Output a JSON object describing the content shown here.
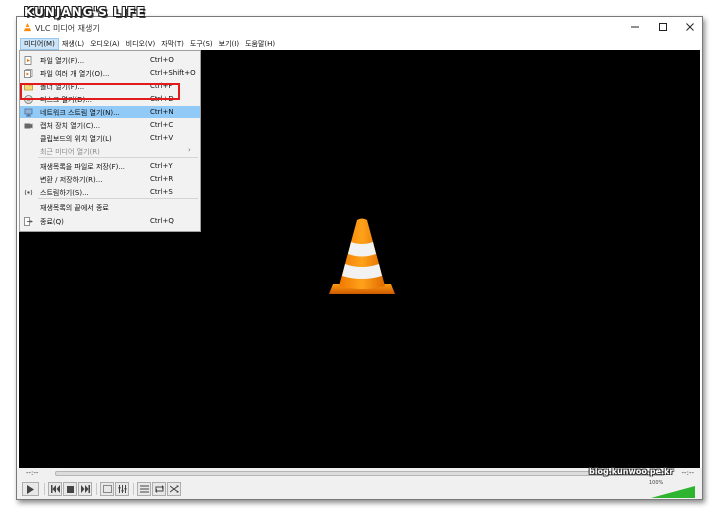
{
  "watermark": "KUNJANG'S LIFE",
  "site_mark": "blog.kunwoo.pe.kr",
  "window": {
    "title": "VLC 미디어 재생기",
    "min_icon": "minimize-icon",
    "max_icon": "maximize-icon",
    "close_icon": "close-icon"
  },
  "menubar": [
    {
      "label": "미디어(M)"
    },
    {
      "label": "재생(L)"
    },
    {
      "label": "오디오(A)"
    },
    {
      "label": "비디오(V)"
    },
    {
      "label": "자막(T)"
    },
    {
      "label": "도구(S)"
    },
    {
      "label": "보기(I)"
    },
    {
      "label": "도움말(H)"
    }
  ],
  "media_menu": [
    {
      "label": "파일 열기(F)...",
      "shortcut": "Ctrl+O",
      "icon": "file-open-icon"
    },
    {
      "label": "파일 여러 개 열기(O)...",
      "shortcut": "Ctrl+Shift+O",
      "icon": "files-open-icon"
    },
    {
      "label": "폴더 열기(F)...",
      "shortcut": "Ctrl+F",
      "icon": "folder-icon"
    },
    {
      "label": "디스크 열기(D)...",
      "shortcut": "Ctrl+D",
      "icon": "disc-icon"
    },
    {
      "label": "네트워크 스트림 열기(N)...",
      "shortcut": "Ctrl+N",
      "icon": "network-icon"
    },
    {
      "label": "캡처 장치 열기(C)...",
      "shortcut": "Ctrl+C",
      "icon": "capture-icon"
    },
    {
      "label": "클립보드의 위치 열기(L)",
      "shortcut": "Ctrl+V",
      "icon": ""
    },
    {
      "label": "최근 미디어 열기(R)",
      "shortcut": "",
      "icon": ""
    },
    {
      "label": "재생목록을 파일로 저장(F)...",
      "shortcut": "Ctrl+Y",
      "icon": ""
    },
    {
      "label": "변환 / 저장하기(R)...",
      "shortcut": "Ctrl+R",
      "icon": ""
    },
    {
      "label": "스트림하기(S)...",
      "shortcut": "Ctrl+S",
      "icon": "stream-icon"
    },
    {
      "label": "재생목록의 끝에서 종료",
      "shortcut": "",
      "icon": ""
    },
    {
      "label": "종료(Q)",
      "shortcut": "Ctrl+Q",
      "icon": "exit-icon"
    }
  ],
  "submenu_arrow": "›",
  "seek": {
    "elapsed": "--:--",
    "remaining": "--:--",
    "progress": 0
  },
  "volume": {
    "label": "100%",
    "level": 1.0
  },
  "colors": {
    "highlight": "#91c9f7",
    "annotation": "#e11a1a",
    "cone": "#ff8800",
    "video_bg": "#000000"
  }
}
